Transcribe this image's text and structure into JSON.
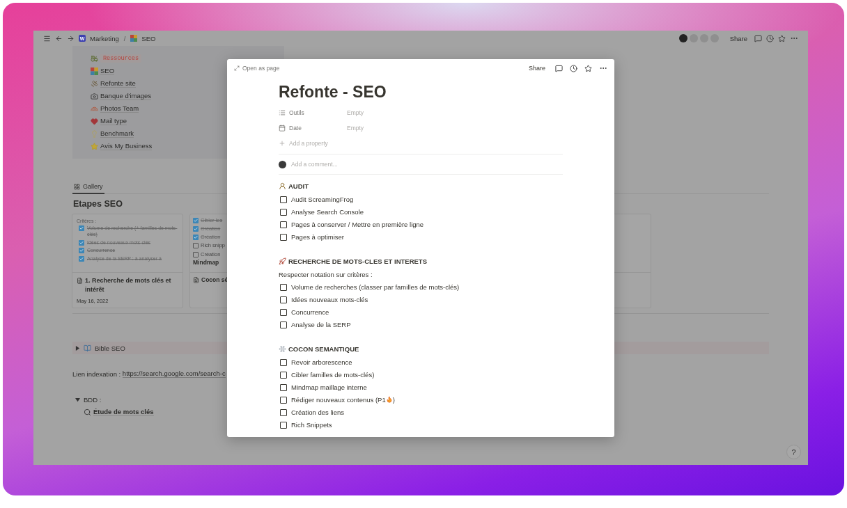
{
  "topbar": {
    "breadcrumbs": [
      {
        "label": "Marketing",
        "badge": "W"
      },
      {
        "label": "SEO"
      }
    ],
    "separator": "/",
    "share": "Share"
  },
  "callout": {
    "items": [
      {
        "label": "Ressources",
        "kind": "code"
      },
      {
        "label": "SEO",
        "kind": "link"
      },
      {
        "label": "Refonte site",
        "kind": "link"
      },
      {
        "label": "Banque d'images",
        "kind": "link"
      },
      {
        "label": "Photos Team",
        "kind": "link"
      },
      {
        "label": "Mail type",
        "kind": "link"
      },
      {
        "label": "Benchmark",
        "kind": "link"
      },
      {
        "label": "Avis My Business",
        "kind": "link"
      }
    ]
  },
  "gallery": {
    "tab": "Gallery",
    "title": "Etapes SEO",
    "cards": [
      {
        "preview_heading": "Critères :",
        "checklist": [
          {
            "label": "Volume de recherche (+ familles de mots-clés)",
            "checked": true
          },
          {
            "label": "Idées de nouveaux mots-clés",
            "checked": true
          },
          {
            "label": "Concurrence",
            "checked": true
          },
          {
            "label": "Analyse de la SERP : à analyser à",
            "checked": true
          }
        ],
        "title": "1. Recherche de mots clés et intérêt",
        "date": "May 16, 2022"
      },
      {
        "checklist": [
          {
            "label": "Cibler les",
            "checked": true
          },
          {
            "label": "Création",
            "checked": true
          },
          {
            "label": "Création",
            "checked": true
          },
          {
            "label": "Rich snipp",
            "checked": false
          },
          {
            "label": "Création",
            "checked": false
          }
        ],
        "preview_footer": "Mindmap",
        "title": "Cocon sé"
      }
    ]
  },
  "toggle": {
    "label": "Bible SEO",
    "expanded": false
  },
  "link_line": {
    "label": "Lien indexation : ",
    "url": "https://search.google.com/search-c"
  },
  "database_toggle": {
    "label": "BDD :",
    "expanded": true,
    "children": [
      {
        "label": "Étude de mots clés"
      }
    ]
  },
  "help": "?",
  "modal": {
    "open_as_page": "Open as page",
    "share": "Share",
    "title": "Refonte - SEO",
    "properties": [
      {
        "kind": "list",
        "label": "Outils",
        "value": "Empty"
      },
      {
        "kind": "date",
        "label": "Date",
        "value": "Empty"
      }
    ],
    "add_property": "Add a property",
    "comment_placeholder": "Add a comment...",
    "sections": [
      {
        "heading": "AUDIT",
        "items": [
          {
            "label": "Audit ScreamingFrog",
            "kind": "plain",
            "checked": false
          },
          {
            "label": "Analyse Search Console",
            "kind": "plain",
            "checked": false
          },
          {
            "label": "Pages à conserver / Mettre en première ligne",
            "kind": "plain",
            "checked": false
          },
          {
            "label": "Pages à optimiser",
            "kind": "plain",
            "checked": false
          }
        ]
      },
      {
        "heading": "RECHERCHE DE MOTS-CLES ET INTERETS",
        "note": "Respecter notation sur critères :",
        "items": [
          {
            "label": "Volume de recherches (classer par familles de mots-clés)",
            "kind": "plain",
            "checked": false
          },
          {
            "label": "Idées nouveaux mots-clés",
            "kind": "plain",
            "checked": false
          },
          {
            "label": "Concurrence",
            "kind": "plain",
            "checked": false
          },
          {
            "label": "Analyse de la SERP",
            "kind": "plain",
            "checked": false
          }
        ]
      },
      {
        "heading": "COCON SEMANTIQUE",
        "items": [
          {
            "label": "Revoir arborescence",
            "kind": "plain",
            "checked": false
          },
          {
            "label": "Cibler familles de mots-clés)",
            "kind": "plain",
            "checked": false
          },
          {
            "label": "Mindmap maillage interne",
            "kind": "plain",
            "checked": false
          },
          {
            "label": "Rédiger nouveaux contenus (P1",
            "kind": "flame",
            "tail": ")",
            "checked": false
          },
          {
            "label": "Création des liens",
            "kind": "plain",
            "checked": false
          },
          {
            "label": "Rich Snippets",
            "kind": "plain",
            "checked": false
          }
        ]
      }
    ]
  }
}
